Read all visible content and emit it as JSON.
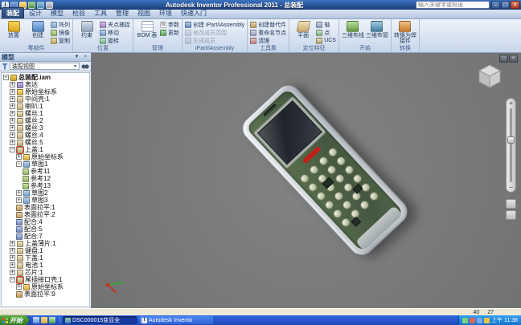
{
  "window": {
    "title": "Autodesk Inventor Professional 2011 - 总装配",
    "search_placeholder": "输入关键字或短语"
  },
  "icons": {
    "app": "I",
    "minimize": "–",
    "maximize": "□",
    "close": "×",
    "doc_restore": "□",
    "doc_close": "×",
    "dropdown_arrow": "▼",
    "zoom_in": "+",
    "zoom_out": "−",
    "expand_plus": "+",
    "expand_minus": "−",
    "inventor_task": "I"
  },
  "ribbon": {
    "active_tab": "装配",
    "tabs": [
      "装配",
      "设计",
      "模型",
      "检验",
      "工具",
      "管理",
      "视图",
      "环境",
      "快速入门"
    ],
    "groups": [
      {
        "label": "零部件",
        "big": [
          {
            "label": "放置",
            "icon": "place"
          },
          {
            "label": "创建",
            "icon": "create"
          }
        ],
        "small": [
          {
            "label": "阵列",
            "icon": "pattern"
          },
          {
            "label": "镜像",
            "icon": "mirror"
          },
          {
            "label": "复制",
            "icon": "copy"
          }
        ]
      },
      {
        "label": "位置",
        "big": [
          {
            "label": "约束",
            "icon": "constrain"
          }
        ],
        "small": [
          {
            "label": "夹点捕捉",
            "icon": "grip-snap"
          },
          {
            "label": "移动",
            "icon": "move"
          },
          {
            "label": "旋转",
            "icon": "rotate"
          }
        ]
      },
      {
        "label": "管理",
        "big": [
          {
            "label": "BOM 表",
            "icon": "bom"
          }
        ],
        "small": [
          {
            "label": "参数",
            "icon": "parameters",
            "glyph": "fx"
          },
          {
            "label": "更新",
            "icon": "update"
          }
        ]
      },
      {
        "label": "iPart/iAssembly",
        "big": [],
        "small": [
          {
            "label": "创建 iPart/iAssembly",
            "icon": "ipart-create"
          },
          {
            "label": "修改成员范围",
            "icon": "ipart-edit",
            "disabled": true
          },
          {
            "label": "生成成员",
            "icon": "ipart-generate",
            "disabled": true
          }
        ]
      },
      {
        "label": "工具集",
        "big": [],
        "small": [
          {
            "label": "创建替代件",
            "icon": "substitute"
          },
          {
            "label": "重命名节点",
            "icon": "rename"
          },
          {
            "label": "清理",
            "icon": "cleanup"
          }
        ]
      },
      {
        "label": "定位特征",
        "big": [
          {
            "label": "平面",
            "icon": "plane"
          }
        ],
        "small": [
          {
            "label": "轴",
            "icon": "axis"
          },
          {
            "label": "点",
            "icon": "point"
          },
          {
            "label": "UCS",
            "icon": "ucs"
          }
        ]
      },
      {
        "label": "开始",
        "big": [
          {
            "label": "三维布线",
            "icon": "harness"
          },
          {
            "label": "三维布管",
            "icon": "piping"
          }
        ],
        "small": []
      },
      {
        "label": "转换",
        "big": [
          {
            "label": "转换为焊接件",
            "icon": "weldment"
          }
        ],
        "small": []
      }
    ]
  },
  "browser": {
    "header": "模型",
    "view_dropdown": "装配视图",
    "tree": [
      {
        "label": "总装配.iam",
        "indent": 0,
        "expand": "minus",
        "icon": "assembly",
        "root": true
      },
      {
        "label": "表达",
        "indent": 1,
        "expand": "plus",
        "icon": "rep"
      },
      {
        "label": "原始坐标系",
        "indent": 1,
        "expand": "plus",
        "icon": "folder"
      },
      {
        "label": "中间壳:1",
        "indent": 1,
        "expand": "plus",
        "icon": "part"
      },
      {
        "label": "喇叭:1",
        "indent": 1,
        "expand": "plus",
        "icon": "part"
      },
      {
        "label": "螺丝:1",
        "indent": 1,
        "expand": "plus",
        "icon": "part"
      },
      {
        "label": "螺丝:2",
        "indent": 1,
        "expand": "plus",
        "icon": "part"
      },
      {
        "label": "螺丝:3",
        "indent": 1,
        "expand": "plus",
        "icon": "part"
      },
      {
        "label": "螺丝:4",
        "indent": 1,
        "expand": "plus",
        "icon": "part"
      },
      {
        "label": "螺丝:5",
        "indent": 1,
        "expand": "plus",
        "icon": "part"
      },
      {
        "label": "上盖:1",
        "indent": 1,
        "expand": "minus",
        "icon": "part-active"
      },
      {
        "label": "原始坐标系",
        "indent": 2,
        "expand": "plus",
        "icon": "folder"
      },
      {
        "label": "草图1",
        "indent": 2,
        "expand": "minus",
        "icon": "sketch"
      },
      {
        "label": "参考11",
        "indent": 3,
        "icon": "ref"
      },
      {
        "label": "参考12",
        "indent": 3,
        "icon": "ref"
      },
      {
        "label": "参考13",
        "indent": 3,
        "icon": "ref"
      },
      {
        "label": "草图2",
        "indent": 2,
        "expand": "plus",
        "icon": "sketch"
      },
      {
        "label": "草图3",
        "indent": 2,
        "expand": "plus",
        "icon": "sketch"
      },
      {
        "label": "表面拉平:1",
        "indent": 2,
        "icon": "feature"
      },
      {
        "label": "表面拉平:2",
        "indent": 2,
        "icon": "feature"
      },
      {
        "label": "配合:4",
        "indent": 2,
        "icon": "mate"
      },
      {
        "label": "配合:5",
        "indent": 2,
        "icon": "mate"
      },
      {
        "label": "配合:7",
        "indent": 2,
        "icon": "mate"
      },
      {
        "label": "上盖薄片:1",
        "indent": 1,
        "expand": "plus",
        "icon": "part"
      },
      {
        "label": "键盘:1",
        "indent": 1,
        "expand": "plus",
        "icon": "part"
      },
      {
        "label": "下盖:1",
        "indent": 1,
        "expand": "plus",
        "icon": "part"
      },
      {
        "label": "电池:1",
        "indent": 1,
        "expand": "plus",
        "icon": "part"
      },
      {
        "label": "芯片:1",
        "indent": 1,
        "expand": "plus",
        "icon": "part"
      },
      {
        "label": "尾插接口壳:1",
        "indent": 1,
        "expand": "minus",
        "icon": "part-active"
      },
      {
        "label": "原始坐标系",
        "indent": 2,
        "expand": "plus",
        "icon": "folder"
      },
      {
        "label": "表面拉平:9",
        "indent": 2,
        "icon": "feature"
      }
    ]
  },
  "status_bar": {
    "left": "",
    "values": [
      "40",
      "27"
    ]
  },
  "taskbar": {
    "start": "开始",
    "tasks": [
      {
        "label": "DSC000015变显全",
        "active": true,
        "icon": "photo"
      },
      {
        "label": "Autodesk Invento",
        "active": false,
        "icon": "inventor"
      }
    ],
    "time": "上午 11:38"
  }
}
